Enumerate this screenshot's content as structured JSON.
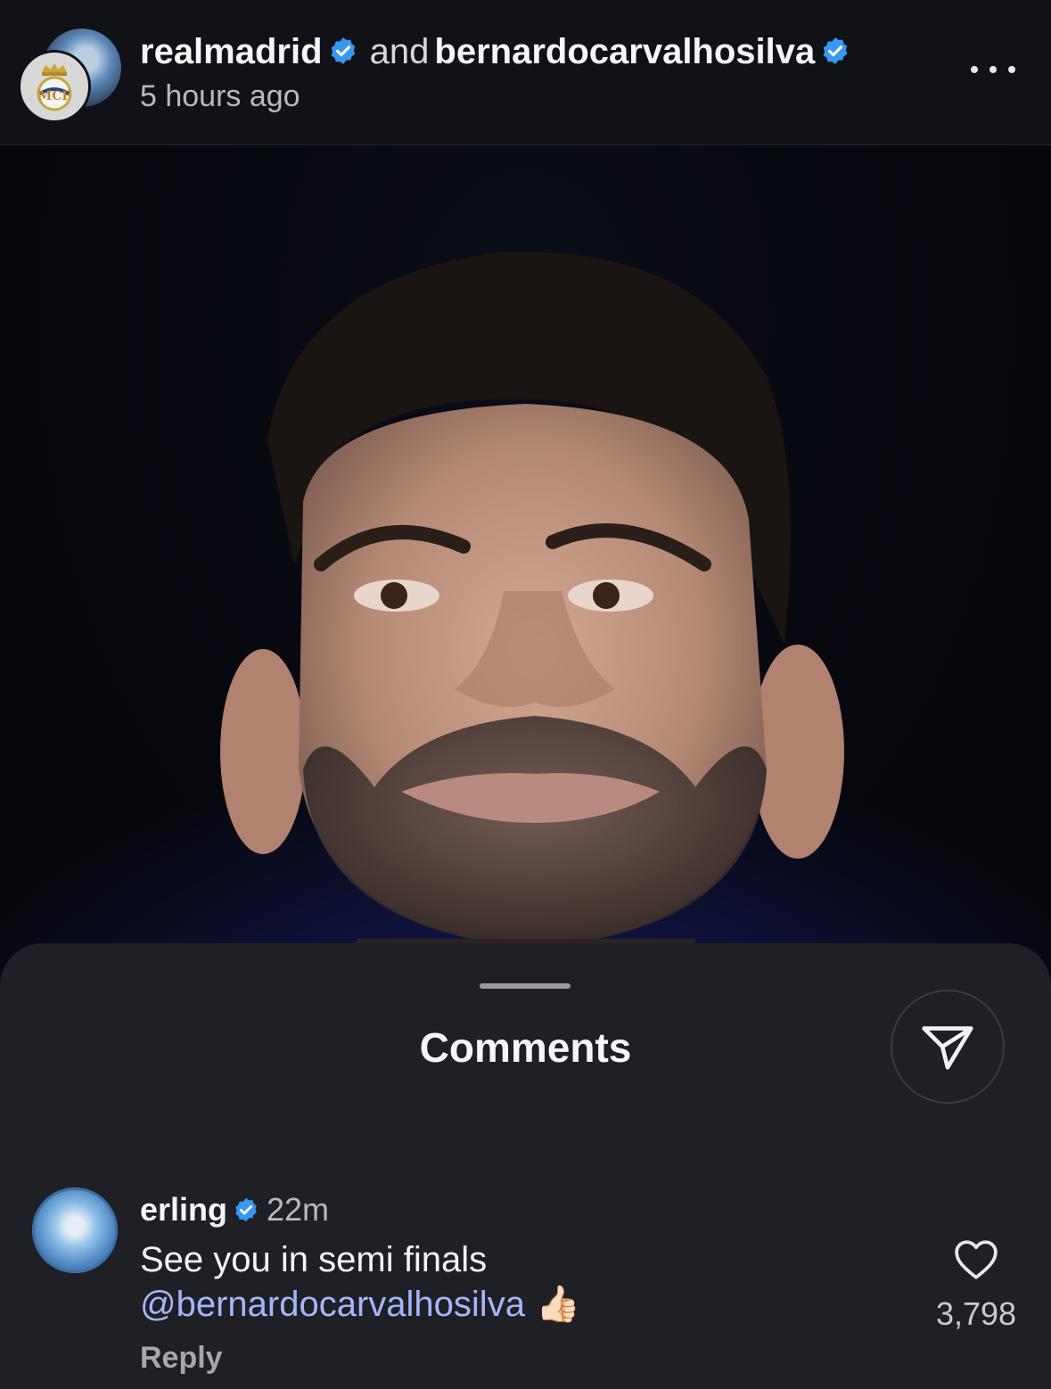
{
  "post": {
    "author1": "realmadrid",
    "conjunction": "and",
    "author2": "bernardocarvalhosilva",
    "time": "5 hours ago"
  },
  "icons": {
    "verified": "verified-badge-icon",
    "more": "more-options-icon",
    "share": "share-send-icon",
    "like": "heart-icon"
  },
  "colors": {
    "verified_badge": "#3897f0",
    "mention": "#a4b6f8",
    "sheet_bg": "#1f2026",
    "header_bg": "#101217"
  },
  "sheet": {
    "title": "Comments"
  },
  "comments": [
    {
      "user": "erling",
      "time": "22m",
      "text": "See you in semi finals",
      "mention": "@bernardocarvalhosilva",
      "emoji": "👍🏻",
      "reply_label": "Reply",
      "likes": "3,798"
    }
  ]
}
